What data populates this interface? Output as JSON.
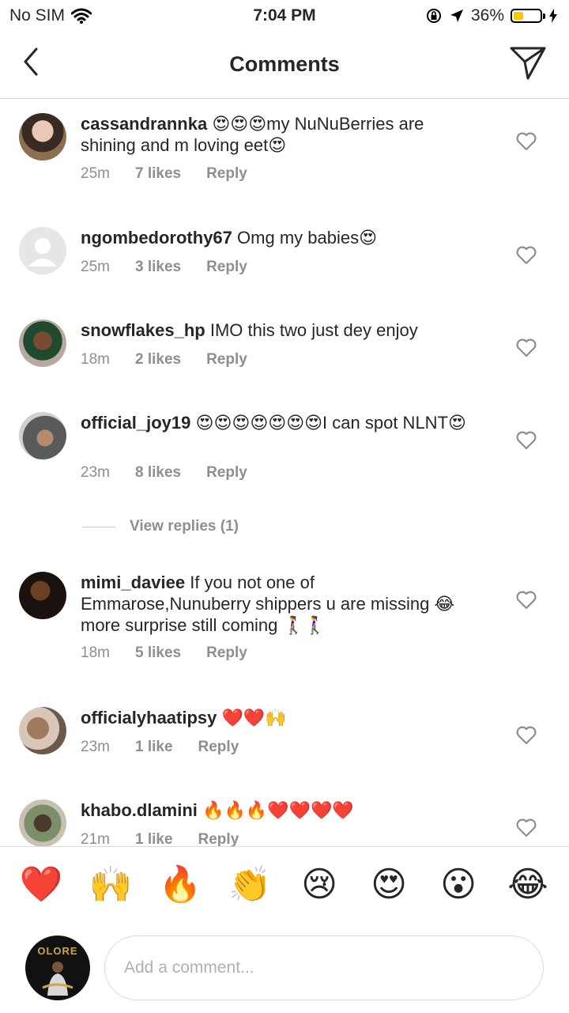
{
  "status_bar": {
    "carrier": "No SIM",
    "time": "7:04 PM",
    "battery_percent": "36%",
    "battery_level": 0.36
  },
  "header": {
    "title": "Comments"
  },
  "comments": [
    {
      "user": "cassandrannka",
      "text": "😍😍😍my NuNuBerries are shining and m loving eet😍",
      "time": "25m",
      "likes": "7 likes",
      "reply": "Reply"
    },
    {
      "user": "ngombedorothy67",
      "text": "Omg my babies😍",
      "time": "25m",
      "likes": "3 likes",
      "reply": "Reply"
    },
    {
      "user": "snowflakes_hp",
      "text": "IMO this two just dey enjoy",
      "time": "18m",
      "likes": "2 likes",
      "reply": "Reply"
    },
    {
      "user": "official_joy19",
      "text": "😍😍😍😍😍😍😍I can spot NLNT😍",
      "time": "23m",
      "likes": "8 likes",
      "reply": "Reply"
    },
    {
      "user": "mimi_daviee",
      "text": "If you not one of Emmarose,Nunuberry shippers u are missing 😂 more surprise still coming 🚶‍♀️🚶‍♀️",
      "time": "18m",
      "likes": "5 likes",
      "reply": "Reply"
    },
    {
      "user": "officialyhaatipsy",
      "text": "❤️❤️🙌",
      "time": "23m",
      "likes": "1 like",
      "reply": "Reply"
    },
    {
      "user": "khabo.dlamini",
      "text": "🔥🔥🔥❤️❤️❤️❤️",
      "time": "21m",
      "likes": "1 like",
      "reply": "Reply"
    }
  ],
  "view_replies": "View replies (1)",
  "quick_emojis": [
    "❤️",
    "🙌",
    "🔥",
    "👏",
    "😢",
    "😍",
    "😮",
    "😂"
  ],
  "composer": {
    "placeholder": "Add a comment...",
    "avatar_text": "OLORE"
  }
}
